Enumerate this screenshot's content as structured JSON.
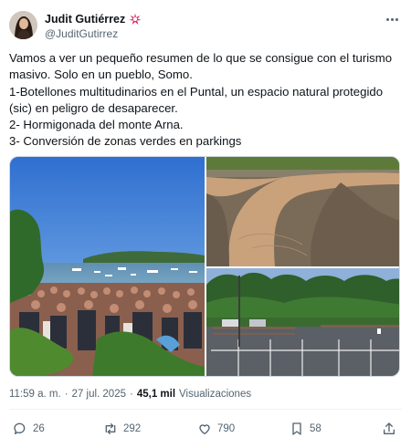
{
  "author": {
    "display_name": "Judit Gutiérrez",
    "handle": "@JuditGutirrez",
    "name_emoji": "sparkle-heart-icon"
  },
  "tweet": {
    "lines": [
      "Vamos a ver un pequeño resumen de lo que se consigue con el turismo",
      "masivo. Solo en un pueblo, Somo.",
      "1-Botellones multitudinarios en el Puntal, un espacio natural protegido",
      "(sic) en peligro de desaparecer.",
      "2- Hormigonada del monte Arna.",
      "3- Conversión de zonas verdes en parkings"
    ]
  },
  "media": {
    "images": [
      {
        "name": "crowd-beach-image"
      },
      {
        "name": "dirt-path-image"
      },
      {
        "name": "parking-lot-image"
      }
    ]
  },
  "meta": {
    "time": "11:59 a. m.",
    "separator": "·",
    "date": "27 jul. 2025",
    "views_count": "45,1 mil",
    "views_label": "Visualizaciones"
  },
  "actions": {
    "replies": "26",
    "reposts": "292",
    "likes": "790",
    "bookmarks": "58"
  },
  "colors": {
    "text": "#0f1419",
    "secondary": "#536471",
    "divider": "#eff3f4",
    "emoji": "#e0245e"
  }
}
